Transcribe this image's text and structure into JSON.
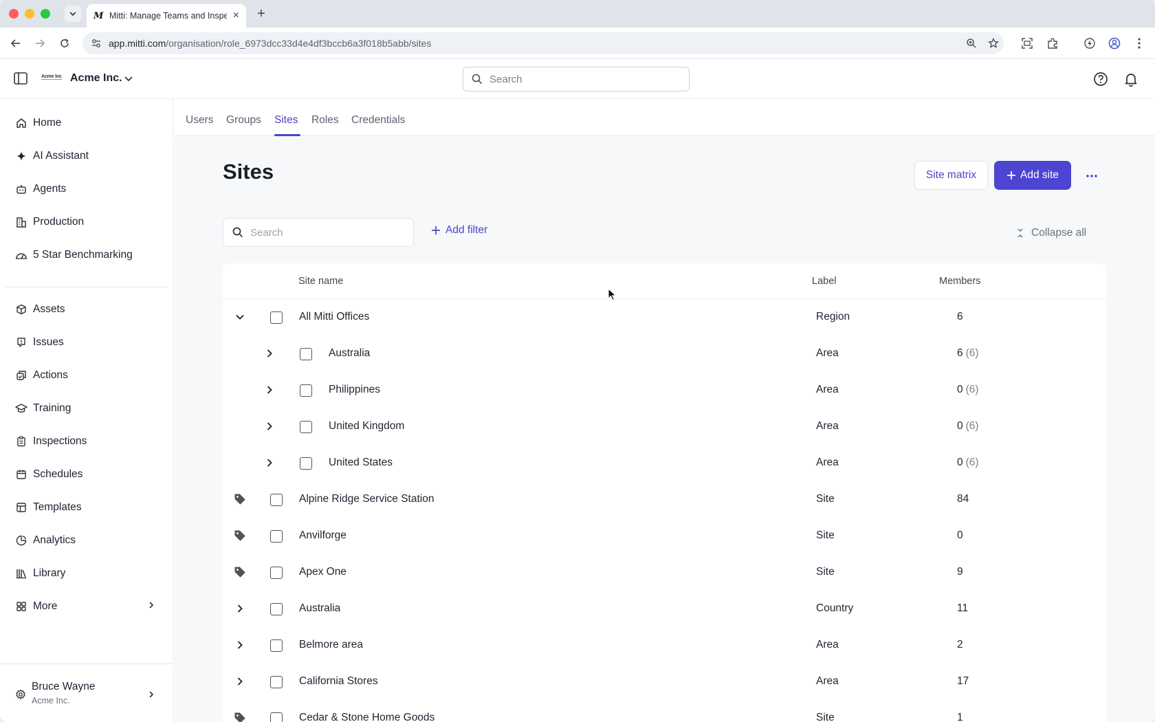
{
  "browser": {
    "tab_title": "Mitti: Manage Teams and Inspections",
    "url_host": "app.mitti.com",
    "url_path": "/organisation/role_6973dcc33d4e4df3bccb6a3f018b5abb/sites"
  },
  "header": {
    "org_logo_text": "Acme Inc",
    "org_name": "Acme Inc.",
    "search_placeholder": "Search"
  },
  "sidebar": {
    "items": [
      {
        "label": "Home",
        "icon": "home-icon"
      },
      {
        "label": "AI Assistant",
        "icon": "sparkle-icon"
      },
      {
        "label": "Agents",
        "icon": "robot-icon"
      },
      {
        "label": "Production",
        "icon": "building-icon"
      },
      {
        "label": "5 Star Benchmarking",
        "icon": "gauge-icon"
      },
      {
        "label": "Assets",
        "icon": "cube-icon"
      },
      {
        "label": "Issues",
        "icon": "alert-icon"
      },
      {
        "label": "Actions",
        "icon": "actions-icon"
      },
      {
        "label": "Training",
        "icon": "graduation-icon"
      },
      {
        "label": "Inspections",
        "icon": "clipboard-icon"
      },
      {
        "label": "Schedules",
        "icon": "calendar-icon"
      },
      {
        "label": "Templates",
        "icon": "template-icon"
      },
      {
        "label": "Analytics",
        "icon": "pie-chart-icon"
      },
      {
        "label": "Library",
        "icon": "library-icon"
      },
      {
        "label": "More",
        "icon": "grid-icon"
      }
    ],
    "user": {
      "name": "Bruce Wayne",
      "org": "Acme Inc."
    }
  },
  "subtabs": [
    "Users",
    "Groups",
    "Sites",
    "Roles",
    "Credentials"
  ],
  "active_subtab": "Sites",
  "page": {
    "title": "Sites",
    "site_matrix_label": "Site matrix",
    "add_site_label": "Add site",
    "search_placeholder": "Search",
    "add_filter_label": "Add filter",
    "collapse_all_label": "Collapse all"
  },
  "table": {
    "columns": [
      "Site name",
      "Label",
      "Members"
    ],
    "rows": [
      {
        "name": "All Mitti Offices",
        "label": "Region",
        "members": "6",
        "members_sub": "",
        "level": 0,
        "control": "chevron-down"
      },
      {
        "name": "Australia",
        "label": "Area",
        "members": "6",
        "members_sub": "(6)",
        "level": 1,
        "control": "chevron-right"
      },
      {
        "name": "Philippines",
        "label": "Area",
        "members": "0",
        "members_sub": "(6)",
        "level": 1,
        "control": "chevron-right"
      },
      {
        "name": "United Kingdom",
        "label": "Area",
        "members": "0",
        "members_sub": "(6)",
        "level": 1,
        "control": "chevron-right"
      },
      {
        "name": "United States",
        "label": "Area",
        "members": "0",
        "members_sub": "(6)",
        "level": 1,
        "control": "chevron-right"
      },
      {
        "name": "Alpine Ridge Service Station",
        "label": "Site",
        "members": "84",
        "members_sub": "",
        "level": 0,
        "control": "tag"
      },
      {
        "name": "Anvilforge",
        "label": "Site",
        "members": "0",
        "members_sub": "",
        "level": 0,
        "control": "tag"
      },
      {
        "name": "Apex One",
        "label": "Site",
        "members": "9",
        "members_sub": "",
        "level": 0,
        "control": "tag"
      },
      {
        "name": "Australia",
        "label": "Country",
        "members": "11",
        "members_sub": "",
        "level": 0,
        "control": "chevron-right"
      },
      {
        "name": "Belmore area",
        "label": "Area",
        "members": "2",
        "members_sub": "",
        "level": 0,
        "control": "chevron-right"
      },
      {
        "name": "California Stores",
        "label": "Area",
        "members": "17",
        "members_sub": "",
        "level": 0,
        "control": "chevron-right"
      },
      {
        "name": "Cedar & Stone Home Goods",
        "label": "Site",
        "members": "1",
        "members_sub": "",
        "level": 0,
        "control": "tag"
      }
    ]
  },
  "colors": {
    "accent": "#4d44d2",
    "accent_text": "#4b45c6"
  }
}
